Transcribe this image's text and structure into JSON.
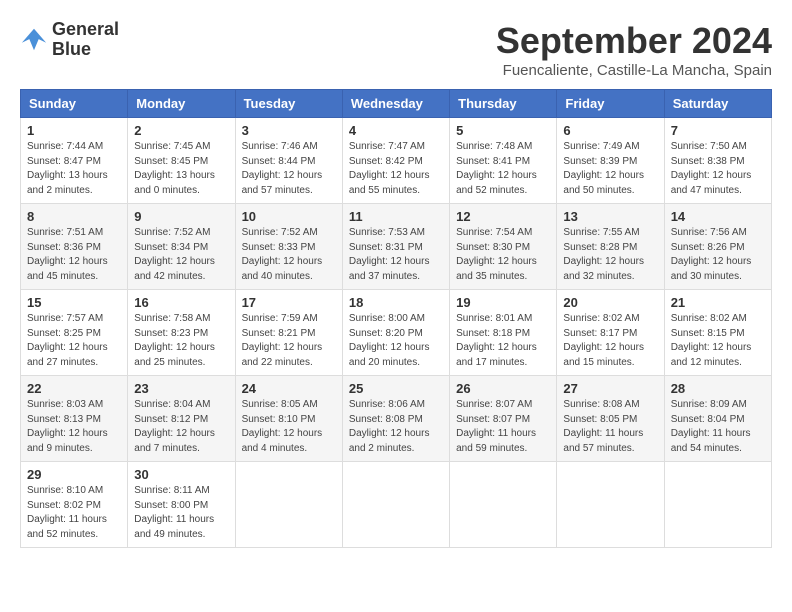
{
  "logo": {
    "line1": "General",
    "line2": "Blue"
  },
  "title": "September 2024",
  "subtitle": "Fuencaliente, Castille-La Mancha, Spain",
  "weekdays": [
    "Sunday",
    "Monday",
    "Tuesday",
    "Wednesday",
    "Thursday",
    "Friday",
    "Saturday"
  ],
  "weeks": [
    [
      {
        "day": "1",
        "info": "Sunrise: 7:44 AM\nSunset: 8:47 PM\nDaylight: 13 hours\nand 2 minutes."
      },
      {
        "day": "2",
        "info": "Sunrise: 7:45 AM\nSunset: 8:45 PM\nDaylight: 13 hours\nand 0 minutes."
      },
      {
        "day": "3",
        "info": "Sunrise: 7:46 AM\nSunset: 8:44 PM\nDaylight: 12 hours\nand 57 minutes."
      },
      {
        "day": "4",
        "info": "Sunrise: 7:47 AM\nSunset: 8:42 PM\nDaylight: 12 hours\nand 55 minutes."
      },
      {
        "day": "5",
        "info": "Sunrise: 7:48 AM\nSunset: 8:41 PM\nDaylight: 12 hours\nand 52 minutes."
      },
      {
        "day": "6",
        "info": "Sunrise: 7:49 AM\nSunset: 8:39 PM\nDaylight: 12 hours\nand 50 minutes."
      },
      {
        "day": "7",
        "info": "Sunrise: 7:50 AM\nSunset: 8:38 PM\nDaylight: 12 hours\nand 47 minutes."
      }
    ],
    [
      {
        "day": "8",
        "info": "Sunrise: 7:51 AM\nSunset: 8:36 PM\nDaylight: 12 hours\nand 45 minutes."
      },
      {
        "day": "9",
        "info": "Sunrise: 7:52 AM\nSunset: 8:34 PM\nDaylight: 12 hours\nand 42 minutes."
      },
      {
        "day": "10",
        "info": "Sunrise: 7:52 AM\nSunset: 8:33 PM\nDaylight: 12 hours\nand 40 minutes."
      },
      {
        "day": "11",
        "info": "Sunrise: 7:53 AM\nSunset: 8:31 PM\nDaylight: 12 hours\nand 37 minutes."
      },
      {
        "day": "12",
        "info": "Sunrise: 7:54 AM\nSunset: 8:30 PM\nDaylight: 12 hours\nand 35 minutes."
      },
      {
        "day": "13",
        "info": "Sunrise: 7:55 AM\nSunset: 8:28 PM\nDaylight: 12 hours\nand 32 minutes."
      },
      {
        "day": "14",
        "info": "Sunrise: 7:56 AM\nSunset: 8:26 PM\nDaylight: 12 hours\nand 30 minutes."
      }
    ],
    [
      {
        "day": "15",
        "info": "Sunrise: 7:57 AM\nSunset: 8:25 PM\nDaylight: 12 hours\nand 27 minutes."
      },
      {
        "day": "16",
        "info": "Sunrise: 7:58 AM\nSunset: 8:23 PM\nDaylight: 12 hours\nand 25 minutes."
      },
      {
        "day": "17",
        "info": "Sunrise: 7:59 AM\nSunset: 8:21 PM\nDaylight: 12 hours\nand 22 minutes."
      },
      {
        "day": "18",
        "info": "Sunrise: 8:00 AM\nSunset: 8:20 PM\nDaylight: 12 hours\nand 20 minutes."
      },
      {
        "day": "19",
        "info": "Sunrise: 8:01 AM\nSunset: 8:18 PM\nDaylight: 12 hours\nand 17 minutes."
      },
      {
        "day": "20",
        "info": "Sunrise: 8:02 AM\nSunset: 8:17 PM\nDaylight: 12 hours\nand 15 minutes."
      },
      {
        "day": "21",
        "info": "Sunrise: 8:02 AM\nSunset: 8:15 PM\nDaylight: 12 hours\nand 12 minutes."
      }
    ],
    [
      {
        "day": "22",
        "info": "Sunrise: 8:03 AM\nSunset: 8:13 PM\nDaylight: 12 hours\nand 9 minutes."
      },
      {
        "day": "23",
        "info": "Sunrise: 8:04 AM\nSunset: 8:12 PM\nDaylight: 12 hours\nand 7 minutes."
      },
      {
        "day": "24",
        "info": "Sunrise: 8:05 AM\nSunset: 8:10 PM\nDaylight: 12 hours\nand 4 minutes."
      },
      {
        "day": "25",
        "info": "Sunrise: 8:06 AM\nSunset: 8:08 PM\nDaylight: 12 hours\nand 2 minutes."
      },
      {
        "day": "26",
        "info": "Sunrise: 8:07 AM\nSunset: 8:07 PM\nDaylight: 11 hours\nand 59 minutes."
      },
      {
        "day": "27",
        "info": "Sunrise: 8:08 AM\nSunset: 8:05 PM\nDaylight: 11 hours\nand 57 minutes."
      },
      {
        "day": "28",
        "info": "Sunrise: 8:09 AM\nSunset: 8:04 PM\nDaylight: 11 hours\nand 54 minutes."
      }
    ],
    [
      {
        "day": "29",
        "info": "Sunrise: 8:10 AM\nSunset: 8:02 PM\nDaylight: 11 hours\nand 52 minutes."
      },
      {
        "day": "30",
        "info": "Sunrise: 8:11 AM\nSunset: 8:00 PM\nDaylight: 11 hours\nand 49 minutes."
      },
      {
        "day": "",
        "info": ""
      },
      {
        "day": "",
        "info": ""
      },
      {
        "day": "",
        "info": ""
      },
      {
        "day": "",
        "info": ""
      },
      {
        "day": "",
        "info": ""
      }
    ]
  ]
}
